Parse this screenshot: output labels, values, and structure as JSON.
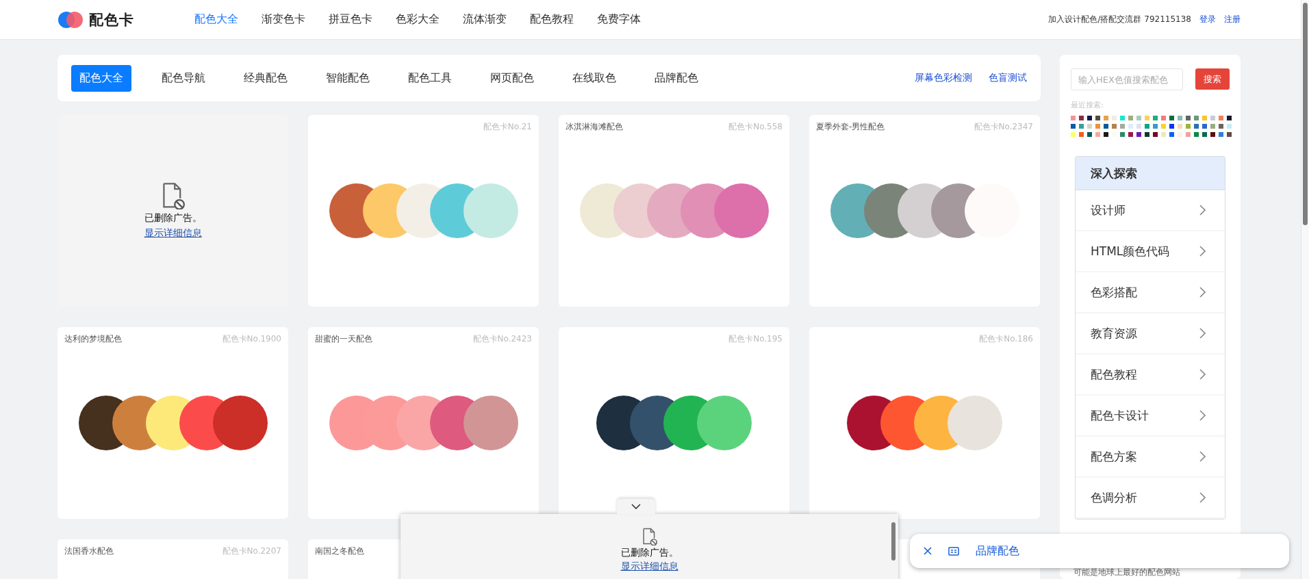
{
  "logo": {
    "text": "配色卡"
  },
  "nav": [
    {
      "label": "配色大全",
      "selected": true
    },
    {
      "label": "渐变色卡",
      "selected": false
    },
    {
      "label": "拼豆色卡",
      "selected": false
    },
    {
      "label": "色彩大全",
      "selected": false
    },
    {
      "label": "流体渐变",
      "selected": false
    },
    {
      "label": "配色教程",
      "selected": false
    },
    {
      "label": "免费字体",
      "selected": false
    }
  ],
  "header_links": {
    "group_text": "加入设计配色/搭配交流群 792115138",
    "login": "登录",
    "register": "注册"
  },
  "tabs": [
    {
      "label": "配色大全",
      "selected": true
    },
    {
      "label": "配色导航",
      "selected": false
    },
    {
      "label": "经典配色",
      "selected": false
    },
    {
      "label": "智能配色",
      "selected": false
    },
    {
      "label": "配色工具",
      "selected": false
    },
    {
      "label": "网页配色",
      "selected": false
    },
    {
      "label": "在线取色",
      "selected": false
    },
    {
      "label": "品牌配色",
      "selected": false
    }
  ],
  "tool_links": [
    "屏幕色彩检测",
    "色盲测试"
  ],
  "cards": [
    {
      "kind": "ad",
      "message": "已删除广告。",
      "link": "显示详细信息"
    },
    {
      "kind": "palette",
      "number": "配色卡No.21",
      "colors": [
        {
          "color": "#c8603a"
        },
        {
          "color": "#fdc868"
        },
        {
          "color": "#f3efe6"
        },
        {
          "color": "#5ecbd8"
        },
        {
          "color": "#c4ebe3"
        }
      ]
    },
    {
      "kind": "palette",
      "title": "冰淇淋海滩配色",
      "number": "配色卡No.558",
      "colors": [
        {
          "color": "#eeead6"
        },
        {
          "color": "#eccdd0"
        },
        {
          "color": "#e3aac0"
        },
        {
          "color": "#e18fb5"
        },
        {
          "color": "#dd6fab"
        }
      ]
    },
    {
      "kind": "palette",
      "title": "夏季外套-男性配色",
      "number": "配色卡No.2347",
      "colors": [
        {
          "color": "#62b0b5"
        },
        {
          "color": "#7a8478"
        },
        {
          "color": "#d4cfd0"
        },
        {
          "color": "#a5999d"
        },
        {
          "color": "#fffafa"
        }
      ]
    },
    {
      "kind": "palette",
      "title": "达利的梦境配色",
      "number": "配色卡No.1900",
      "colors": [
        {
          "color": "#46301e"
        },
        {
          "color": "#cd803e"
        },
        {
          "color": "#fce97a"
        },
        {
          "color": "#fb4c4b"
        },
        {
          "color": "#cb2f27"
        }
      ]
    },
    {
      "kind": "palette",
      "title": "甜蜜的一天配色",
      "number": "配色卡No.2423",
      "colors": [
        {
          "color": "#fd9898"
        },
        {
          "color": "#fc9a9a"
        },
        {
          "color": "#faa6a6"
        },
        {
          "color": "#de5a7e"
        },
        {
          "color": "#d19595"
        }
      ]
    },
    {
      "kind": "palette",
      "number": "配色卡No.195",
      "colors": [
        {
          "color": "#1e2f3f"
        },
        {
          "color": "#34516b"
        },
        {
          "color": "#22b452"
        },
        {
          "color": "#5bd37d"
        }
      ]
    },
    {
      "kind": "palette",
      "number": "配色卡No.186",
      "colors": [
        {
          "color": "#ab1230"
        },
        {
          "color": "#fd5630"
        },
        {
          "color": "#fdb440"
        },
        {
          "color": "#e8e3dc"
        }
      ]
    },
    {
      "kind": "palette",
      "title": "法国香水配色",
      "number": "配色卡No.2207"
    },
    {
      "kind": "palette",
      "title": "南国之冬配色"
    },
    {
      "kind": "hidden"
    },
    {
      "kind": "hidden"
    }
  ],
  "sidebar": {
    "search": {
      "placeholder": "输入HEX色值搜索配色",
      "button": "搜索"
    },
    "recent_label": "最近搜索:",
    "recent": [
      {
        "color": "#f4939a"
      },
      {
        "color": "#8e2a3f"
      },
      {
        "color": "#0e1a4a"
      },
      {
        "color": "#5a4a3c"
      },
      {
        "color": "#e5a24a"
      },
      {
        "color": "#f3ece4"
      },
      {
        "color": "#18e8d0"
      },
      {
        "color": "#a3ab80"
      },
      {
        "color": "#a8cbc6"
      },
      {
        "color": "#fdd05a"
      },
      {
        "color": "#1ab07a"
      },
      {
        "color": "#f27a86"
      },
      {
        "color": "#076f40"
      },
      {
        "color": "#8bbab6"
      },
      {
        "color": "#646464"
      },
      {
        "color": "#6a9a7a"
      },
      {
        "color": "#fcc42a"
      },
      {
        "color": "#c8ccd6"
      },
      {
        "color": "#f77f5a"
      },
      {
        "color": "#161a2a"
      },
      {
        "color": "#0a5aaa"
      },
      {
        "color": "#3aa096"
      },
      {
        "color": "#dad4c8"
      },
      {
        "color": "#ee9234"
      },
      {
        "color": "#0a5a9a"
      },
      {
        "color": "#b68050"
      },
      {
        "color": "#a3aaa4"
      },
      {
        "color": "#e0ecfc"
      },
      {
        "color": "#dce4ee"
      },
      {
        "color": "#0aa684"
      },
      {
        "color": "#3e98cc"
      },
      {
        "color": "#f8d42a"
      },
      {
        "color": "#0a34fa"
      },
      {
        "color": "#f4dcc4"
      },
      {
        "color": "#9ab830"
      },
      {
        "color": "#2a70b0"
      },
      {
        "color": "#2a68c8"
      },
      {
        "color": "#9aac80"
      },
      {
        "color": "#6a6460"
      },
      {
        "color": "#c0eef0"
      },
      {
        "color": "#fefe6a"
      },
      {
        "color": "#fc5a1a"
      },
      {
        "color": "#0a5a5a"
      },
      {
        "color": "#f8a89a"
      },
      {
        "color": "#1a1a1a"
      },
      {
        "color": "#fcfaf0"
      },
      {
        "color": "#2a8a64"
      },
      {
        "color": "#9a1a4a"
      },
      {
        "color": "#6a1ab0"
      },
      {
        "color": "#0a3a2a"
      },
      {
        "color": "#7a0020"
      },
      {
        "color": "#eee8bc"
      },
      {
        "color": "#0a60fa"
      },
      {
        "color": "#fcf4e4"
      },
      {
        "color": "#f4a0a4"
      },
      {
        "color": "#0a8a40"
      },
      {
        "color": "#0a6a4a"
      },
      {
        "color": "#5a1010"
      },
      {
        "color": "#2a80e0"
      },
      {
        "color": "#604a48"
      }
    ],
    "explore": {
      "title": "深入探索",
      "items": [
        "设计师",
        "HTML颜色代码",
        "色彩搭配",
        "教育资源",
        "配色教程",
        "配色卡设计",
        "配色方案",
        "色调分析"
      ]
    },
    "tagline": "可能是地球上最好的配色网站"
  },
  "bottom_ad": {
    "message": "已删除广告。",
    "link": "显示详细信息"
  },
  "floating_bar": {
    "label": "品牌配色"
  }
}
